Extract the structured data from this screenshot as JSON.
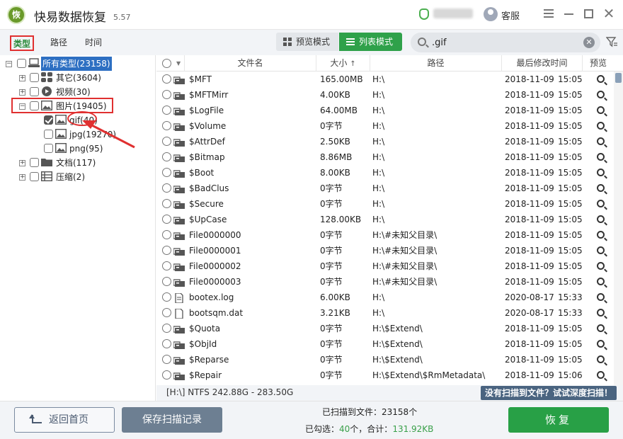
{
  "app": {
    "title": "快易数据恢复",
    "version": "5.57"
  },
  "titlebar": {
    "service_label": "客服"
  },
  "toolbar": {
    "tabs": [
      {
        "label": "类型"
      },
      {
        "label": "路径"
      },
      {
        "label": "时间"
      }
    ],
    "modes": {
      "preview": "预览模式",
      "list": "列表模式"
    },
    "search": {
      "value": ".gif"
    }
  },
  "tree": [
    {
      "label": "所有类型(23158)",
      "icon": "computer-icon"
    },
    {
      "label": "其它(3604)",
      "icon": "grid-icon"
    },
    {
      "label": "视频(30)",
      "icon": "video-icon"
    },
    {
      "label": "图片(19405)",
      "icon": "image-icon"
    },
    {
      "label": "gif(40)",
      "icon": "image-icon",
      "checked": true
    },
    {
      "label": "jpg(19270)",
      "icon": "image-icon"
    },
    {
      "label": "png(95)",
      "icon": "image-icon"
    },
    {
      "label": "文档(117)",
      "icon": "folder-icon"
    },
    {
      "label": "压缩(2)",
      "icon": "archive-icon"
    }
  ],
  "columns": {
    "name": "文件名",
    "size": "大小",
    "path": "路径",
    "modified": "最后修改时间",
    "preview": "预览"
  },
  "files": [
    {
      "name": "$MFT",
      "size": "165.00MB",
      "path": "H:\\",
      "date": "2018-11-09",
      "time": "15:05",
      "icon": "system-file-icon"
    },
    {
      "name": "$MFTMirr",
      "size": "4.00KB",
      "path": "H:\\",
      "date": "2018-11-09",
      "time": "15:05",
      "icon": "system-file-icon"
    },
    {
      "name": "$LogFile",
      "size": "64.00MB",
      "path": "H:\\",
      "date": "2018-11-09",
      "time": "15:05",
      "icon": "system-file-icon"
    },
    {
      "name": "$Volume",
      "size": "0字节",
      "path": "H:\\",
      "date": "2018-11-09",
      "time": "15:05",
      "icon": "system-file-icon"
    },
    {
      "name": "$AttrDef",
      "size": "2.50KB",
      "path": "H:\\",
      "date": "2018-11-09",
      "time": "15:05",
      "icon": "system-file-icon"
    },
    {
      "name": "$Bitmap",
      "size": "8.86MB",
      "path": "H:\\",
      "date": "2018-11-09",
      "time": "15:05",
      "icon": "system-file-icon"
    },
    {
      "name": "$Boot",
      "size": "8.00KB",
      "path": "H:\\",
      "date": "2018-11-09",
      "time": "15:05",
      "icon": "system-file-icon"
    },
    {
      "name": "$BadClus",
      "size": "0字节",
      "path": "H:\\",
      "date": "2018-11-09",
      "time": "15:05",
      "icon": "system-file-icon"
    },
    {
      "name": "$Secure",
      "size": "0字节",
      "path": "H:\\",
      "date": "2018-11-09",
      "time": "15:05",
      "icon": "system-file-icon"
    },
    {
      "name": "$UpCase",
      "size": "128.00KB",
      "path": "H:\\",
      "date": "2018-11-09",
      "time": "15:05",
      "icon": "system-file-icon"
    },
    {
      "name": "File0000000",
      "size": "0字节",
      "path": "H:\\#未知父目录\\",
      "date": "2018-11-09",
      "time": "15:05",
      "icon": "system-file-icon"
    },
    {
      "name": "File0000001",
      "size": "0字节",
      "path": "H:\\#未知父目录\\",
      "date": "2018-11-09",
      "time": "15:05",
      "icon": "system-file-icon"
    },
    {
      "name": "File0000002",
      "size": "0字节",
      "path": "H:\\#未知父目录\\",
      "date": "2018-11-09",
      "time": "15:05",
      "icon": "system-file-icon"
    },
    {
      "name": "File0000003",
      "size": "0字节",
      "path": "H:\\#未知父目录\\",
      "date": "2018-11-09",
      "time": "15:05",
      "icon": "system-file-icon"
    },
    {
      "name": "bootex.log",
      "size": "6.00KB",
      "path": "H:\\",
      "date": "2020-08-17",
      "time": "15:33",
      "icon": "document-icon"
    },
    {
      "name": "bootsqm.dat",
      "size": "3.21KB",
      "path": "H:\\",
      "date": "2020-08-17",
      "time": "15:33",
      "icon": "blank-file-icon"
    },
    {
      "name": "$Quota",
      "size": "0字节",
      "path": "H:\\$Extend\\",
      "date": "2018-11-09",
      "time": "15:05",
      "icon": "system-file-icon"
    },
    {
      "name": "$ObjId",
      "size": "0字节",
      "path": "H:\\$Extend\\",
      "date": "2018-11-09",
      "time": "15:05",
      "icon": "system-file-icon"
    },
    {
      "name": "$Reparse",
      "size": "0字节",
      "path": "H:\\$Extend\\",
      "date": "2018-11-09",
      "time": "15:05",
      "icon": "system-file-icon"
    },
    {
      "name": "$Repair",
      "size": "0字节",
      "path": "H:\\$Extend\\$RmMetadata\\",
      "date": "2018-11-09",
      "time": "15:06",
      "icon": "system-file-icon"
    }
  ],
  "statusbar": {
    "disk_info": "[H:\\] NTFS 242.88G - 283.50G",
    "deep_scan": "没有扫描到文件？试试深度扫描！"
  },
  "bottom": {
    "back_label": "返回首页",
    "save_label": "保存扫描记录",
    "scanned_prefix": "已扫描到文件：",
    "scanned_count": "23158个",
    "selected_prefix": "已勾选：",
    "selected_count": "40",
    "selected_unit": "个，合计：",
    "selected_size": "131.92KB",
    "recover_label": "恢复"
  },
  "colors": {
    "accent": "#2fa14a",
    "highlight": "#e03030",
    "selection": "#2d6fc2"
  }
}
